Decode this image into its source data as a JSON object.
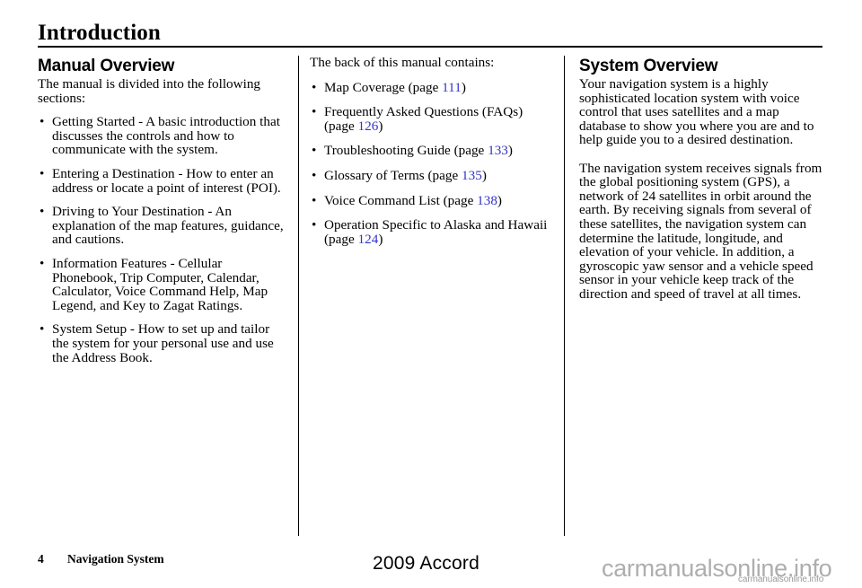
{
  "page": {
    "title": "Introduction"
  },
  "left_column": {
    "heading": "Manual Overview",
    "intro": "The manual is divided into the following sections:",
    "bullets": [
      "Getting Started - A basic introduction that discusses the controls and how to communicate with the system.",
      "Entering a Destination - How to enter an address or locate a point of interest (POI).",
      "Driving to Your Destination - An explanation of the map features, guidance, and cautions.",
      "Information Features - Cellular Phonebook, Trip Computer, Calendar, Calculator, Voice Command Help, Map Legend, and Key to Zagat Ratings.",
      "System Setup - How to set up and tailor the system for your personal use and use the Address Book."
    ]
  },
  "middle_column": {
    "intro": "The back of this manual contains:",
    "bullets": [
      {
        "text_before": "Map Coverage (page ",
        "page": "111",
        "text_after": ")"
      },
      {
        "text_before": "Frequently Asked Questions (FAQs) (page ",
        "page": "126",
        "text_after": ")"
      },
      {
        "text_before": "Troubleshooting Guide (page ",
        "page": "133",
        "text_after": ")"
      },
      {
        "text_before": "Glossary of Terms (page ",
        "page": "135",
        "text_after": ")"
      },
      {
        "text_before": "Voice Command List (page ",
        "page": "138",
        "text_after": ")"
      },
      {
        "text_before": "Operation Specific to Alaska and Hawaii (page ",
        "page": "124",
        "text_after": ")"
      }
    ]
  },
  "right_column": {
    "heading": "System Overview",
    "paragraphs": [
      "Your navigation system is a highly sophisticated location system with voice control that uses satellites and a map database to show you where you are and to help guide you to a desired destination.",
      "The navigation system receives signals from the global positioning system (GPS), a network of 24 satellites in orbit around the earth. By receiving signals from several of these satellites, the navigation system can determine the latitude, longitude, and elevation of your vehicle. In addition, a gyroscopic yaw sensor and a vehicle speed sensor in your vehicle keep track of the direction and speed of travel at all times."
    ]
  },
  "footer": {
    "page_number": "4",
    "section_name": "Navigation System",
    "model_year": "2009  Accord"
  },
  "watermark": {
    "main": "carmanualsonline.info",
    "small": "carmanualsonline.info"
  },
  "colors": {
    "link": "#3333cc",
    "text": "#000000",
    "watermark": "#aeaeae"
  },
  "bullet_glyph": "•"
}
